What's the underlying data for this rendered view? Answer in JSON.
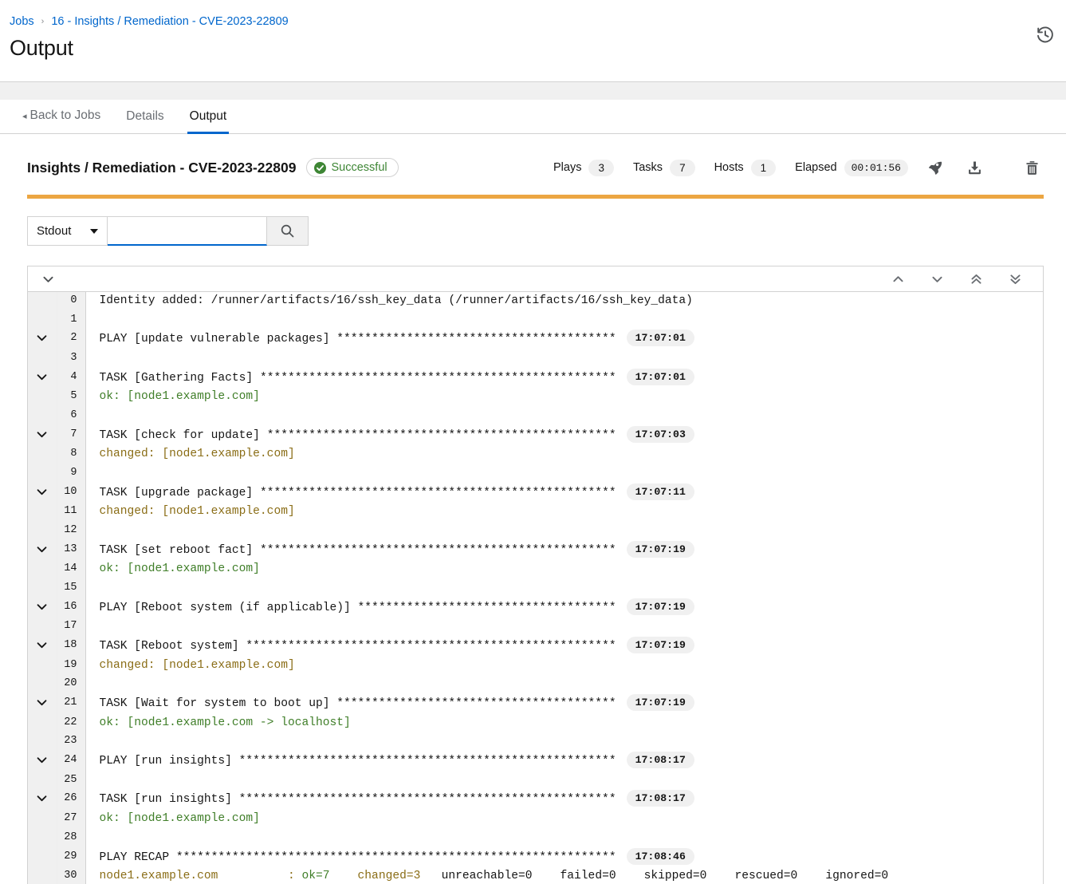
{
  "breadcrumb": {
    "items": [
      {
        "label": "Jobs",
        "link": true
      },
      {
        "label": "16 - Insights / Remediation - CVE-2023-22809",
        "link": true
      }
    ],
    "separator": "›"
  },
  "page": {
    "title": "Output",
    "history_icon": "history-icon"
  },
  "tabs": [
    {
      "label": "Back to Jobs",
      "active": false,
      "caret": "◂"
    },
    {
      "label": "Details",
      "active": false
    },
    {
      "label": "Output",
      "active": true
    }
  ],
  "job": {
    "title": "Insights / Remediation - CVE-2023-22809",
    "status_label": "Successful",
    "status_color": "#3e8635",
    "progress_color": "#eca642",
    "stats": [
      {
        "label": "Plays",
        "value": "3"
      },
      {
        "label": "Tasks",
        "value": "7"
      },
      {
        "label": "Hosts",
        "value": "1"
      },
      {
        "label": "Elapsed",
        "value": "00:01:56",
        "mono": true
      }
    ],
    "actions": [
      {
        "name": "relaunch-icon",
        "title": "Relaunch"
      },
      {
        "name": "download-icon",
        "title": "Download"
      },
      {
        "name": "delete-icon",
        "title": "Delete"
      }
    ]
  },
  "search": {
    "select_value": "Stdout",
    "input_value": "",
    "placeholder": "",
    "button_icon": "search-icon"
  },
  "toolbar": {
    "expand_all_icon": "chevron-down-icon",
    "nav_icons": [
      "chevron-up-icon",
      "chevron-down-icon",
      "double-chevron-up-icon",
      "double-chevron-down-icon"
    ]
  },
  "log": {
    "lines": [
      {
        "num": "0",
        "toggle": false,
        "segments": [
          {
            "t": "Identity added: /runner/artifacts/16/ssh_key_data (/runner/artifacts/16/ssh_key_data)",
            "c": "plain"
          }
        ]
      },
      {
        "num": "1",
        "toggle": false,
        "segments": []
      },
      {
        "num": "2",
        "toggle": true,
        "segments": [
          {
            "t": "PLAY [update vulnerable packages] ",
            "c": "plain"
          },
          {
            "t": "****************************************",
            "c": "stars"
          }
        ],
        "ts": "17:07:01"
      },
      {
        "num": "3",
        "toggle": false,
        "segments": []
      },
      {
        "num": "4",
        "toggle": true,
        "segments": [
          {
            "t": "TASK [Gathering Facts] ",
            "c": "plain"
          },
          {
            "t": "***************************************************",
            "c": "stars"
          }
        ],
        "ts": "17:07:01"
      },
      {
        "num": "5",
        "toggle": false,
        "segments": [
          {
            "t": "ok: [node1.example.com]",
            "c": "ok"
          }
        ]
      },
      {
        "num": "6",
        "toggle": false,
        "segments": []
      },
      {
        "num": "7",
        "toggle": true,
        "segments": [
          {
            "t": "TASK [check for update] ",
            "c": "plain"
          },
          {
            "t": "**************************************************",
            "c": "stars"
          }
        ],
        "ts": "17:07:03"
      },
      {
        "num": "8",
        "toggle": false,
        "segments": [
          {
            "t": "changed: [node1.example.com]",
            "c": "chg"
          }
        ]
      },
      {
        "num": "9",
        "toggle": false,
        "segments": []
      },
      {
        "num": "10",
        "toggle": true,
        "segments": [
          {
            "t": "TASK [upgrade package] ",
            "c": "plain"
          },
          {
            "t": "***************************************************",
            "c": "stars"
          }
        ],
        "ts": "17:07:11"
      },
      {
        "num": "11",
        "toggle": false,
        "segments": [
          {
            "t": "changed: [node1.example.com]",
            "c": "chg"
          }
        ]
      },
      {
        "num": "12",
        "toggle": false,
        "segments": []
      },
      {
        "num": "13",
        "toggle": true,
        "segments": [
          {
            "t": "TASK [set reboot fact] ",
            "c": "plain"
          },
          {
            "t": "***************************************************",
            "c": "stars"
          }
        ],
        "ts": "17:07:19"
      },
      {
        "num": "14",
        "toggle": false,
        "segments": [
          {
            "t": "ok: [node1.example.com]",
            "c": "ok"
          }
        ]
      },
      {
        "num": "15",
        "toggle": false,
        "segments": []
      },
      {
        "num": "16",
        "toggle": true,
        "segments": [
          {
            "t": "PLAY [Reboot system (if applicable)] ",
            "c": "plain"
          },
          {
            "t": "*************************************",
            "c": "stars"
          }
        ],
        "ts": "17:07:19"
      },
      {
        "num": "17",
        "toggle": false,
        "segments": []
      },
      {
        "num": "18",
        "toggle": true,
        "segments": [
          {
            "t": "TASK [Reboot system] ",
            "c": "plain"
          },
          {
            "t": "*****************************************************",
            "c": "stars"
          }
        ],
        "ts": "17:07:19"
      },
      {
        "num": "19",
        "toggle": false,
        "segments": [
          {
            "t": "changed: [node1.example.com]",
            "c": "chg"
          }
        ]
      },
      {
        "num": "20",
        "toggle": false,
        "segments": []
      },
      {
        "num": "21",
        "toggle": true,
        "segments": [
          {
            "t": "TASK [Wait for system to boot up] ",
            "c": "plain"
          },
          {
            "t": "****************************************",
            "c": "stars"
          }
        ],
        "ts": "17:07:19"
      },
      {
        "num": "22",
        "toggle": false,
        "segments": [
          {
            "t": "ok: [node1.example.com -> localhost]",
            "c": "ok"
          }
        ]
      },
      {
        "num": "23",
        "toggle": false,
        "segments": []
      },
      {
        "num": "24",
        "toggle": true,
        "segments": [
          {
            "t": "PLAY [run insights] ",
            "c": "plain"
          },
          {
            "t": "******************************************************",
            "c": "stars"
          }
        ],
        "ts": "17:08:17"
      },
      {
        "num": "25",
        "toggle": false,
        "segments": []
      },
      {
        "num": "26",
        "toggle": true,
        "segments": [
          {
            "t": "TASK [run insights] ",
            "c": "plain"
          },
          {
            "t": "******************************************************",
            "c": "stars"
          }
        ],
        "ts": "17:08:17"
      },
      {
        "num": "27",
        "toggle": false,
        "segments": [
          {
            "t": "ok: [node1.example.com]",
            "c": "ok"
          }
        ]
      },
      {
        "num": "28",
        "toggle": false,
        "segments": []
      },
      {
        "num": "29",
        "toggle": false,
        "segments": [
          {
            "t": "PLAY RECAP ",
            "c": "plain"
          },
          {
            "t": "***************************************************************",
            "c": "stars"
          }
        ],
        "ts": "17:08:46"
      },
      {
        "num": "30",
        "toggle": false,
        "segments": [
          {
            "t": "node1.example.com          : ",
            "c": "chg"
          },
          {
            "t": "ok=7",
            "c": "ok"
          },
          {
            "t": "    ",
            "c": "plain"
          },
          {
            "t": "changed=3",
            "c": "chg"
          },
          {
            "t": "   unreachable=0    failed=0    skipped=0    rescued=0    ignored=0",
            "c": "plain"
          }
        ]
      }
    ]
  }
}
